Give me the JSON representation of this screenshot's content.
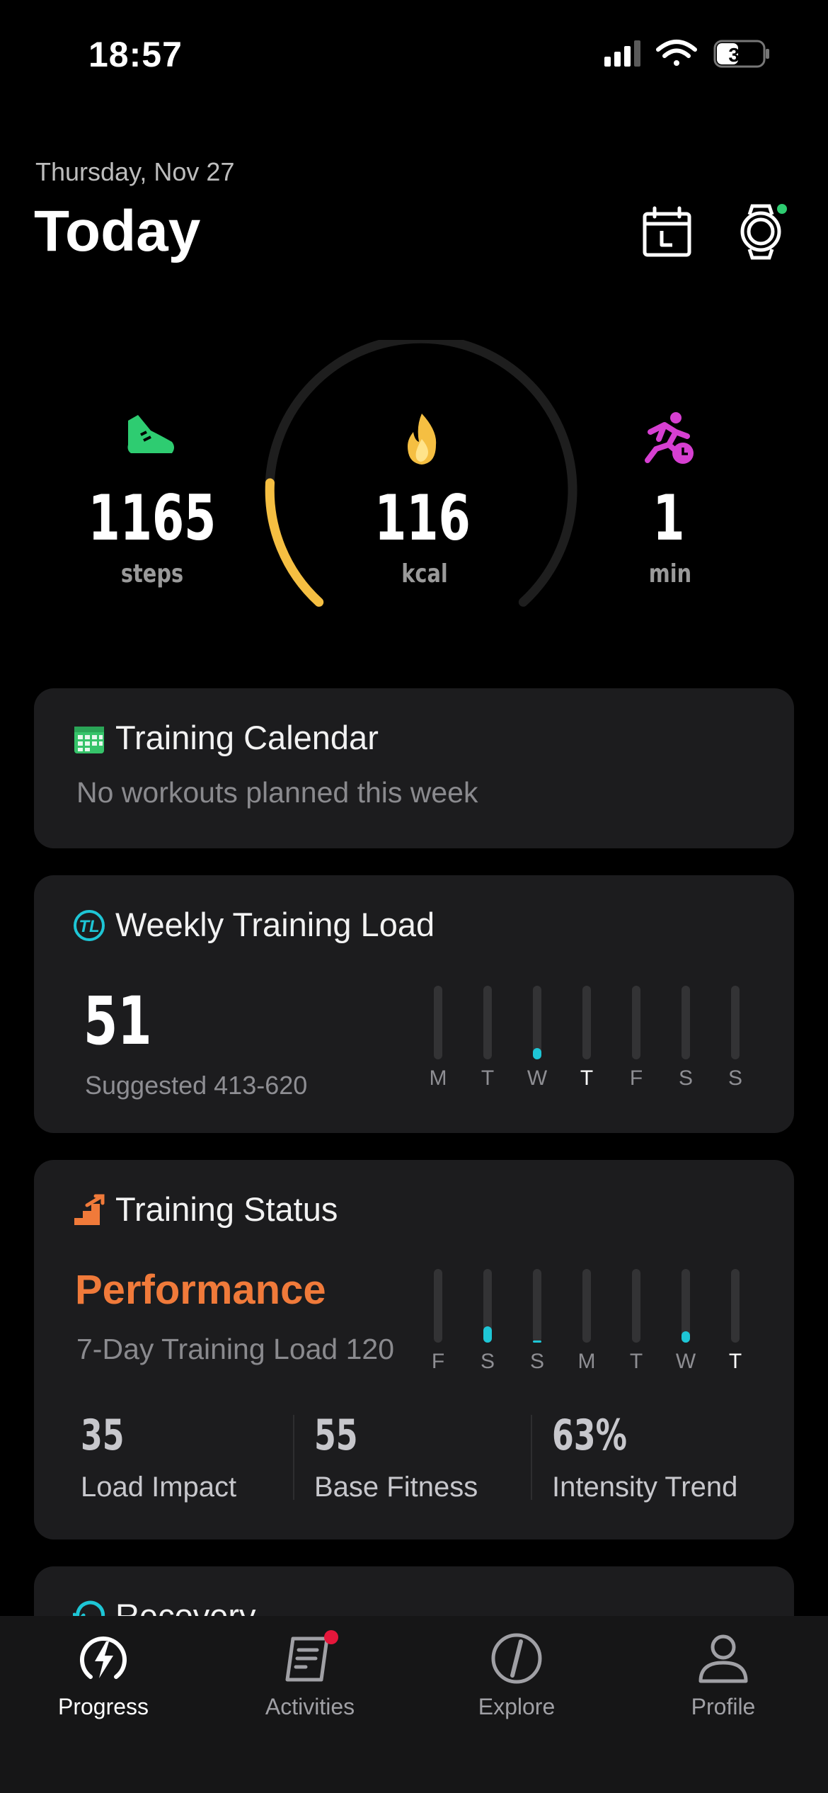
{
  "status_bar": {
    "time": "18:57",
    "battery": "33"
  },
  "header": {
    "date": "Thursday, Nov 27",
    "title": "Today"
  },
  "summary": {
    "steps": {
      "value": "1165",
      "unit": "steps"
    },
    "calories": {
      "value": "116",
      "unit": "kcal"
    },
    "active": {
      "value": "1",
      "unit": "min"
    }
  },
  "training_calendar": {
    "title": "Training Calendar",
    "subtitle": "No workouts planned this week"
  },
  "weekly_load": {
    "title": "Weekly Training Load",
    "value": "51",
    "suggested": "Suggested 413-620",
    "days": [
      {
        "label": "M",
        "level": 0
      },
      {
        "label": "T",
        "level": 0
      },
      {
        "label": "W",
        "level": 0.15
      },
      {
        "label": "T",
        "level": 0,
        "today": true
      },
      {
        "label": "F",
        "level": 0
      },
      {
        "label": "S",
        "level": 0
      },
      {
        "label": "S",
        "level": 0
      }
    ]
  },
  "training_status": {
    "title": "Training Status",
    "status": "Performance",
    "load_text": "7-Day Training Load 120",
    "days": [
      {
        "label": "F",
        "level": 0
      },
      {
        "label": "S",
        "level": 0.22
      },
      {
        "label": "S",
        "level": 0.03
      },
      {
        "label": "M",
        "level": 0
      },
      {
        "label": "T",
        "level": 0
      },
      {
        "label": "W",
        "level": 0.15
      },
      {
        "label": "T",
        "level": 0,
        "today": true
      }
    ],
    "stats": [
      {
        "value": "35",
        "label": "Load Impact"
      },
      {
        "value": "55",
        "label": "Base Fitness"
      },
      {
        "value": "63%",
        "label": "Intensity Trend"
      }
    ]
  },
  "recovery": {
    "title": "Recovery"
  },
  "tabs": [
    {
      "label": "Progress",
      "icon": "progress-bolt-icon"
    },
    {
      "label": "Activities",
      "icon": "activities-icon"
    },
    {
      "label": "Explore",
      "icon": "compass-icon"
    },
    {
      "label": "Profile",
      "icon": "person-icon"
    }
  ],
  "colors": {
    "accent_status": "#f07a3a",
    "load_bar": "#1ec6d6",
    "calorie_arc": "#f5bf42",
    "steps": "#2ecc71",
    "active": "#d63fd1"
  }
}
